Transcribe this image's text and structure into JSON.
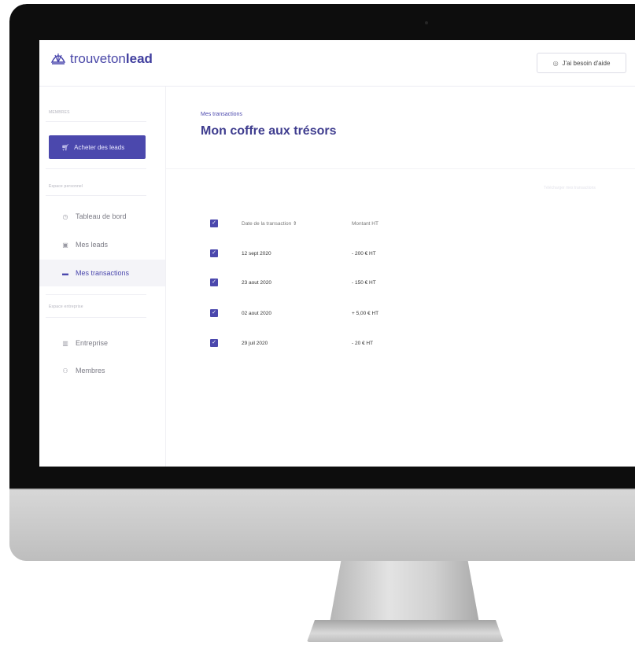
{
  "brand": {
    "name_light": "trouveton",
    "name_bold": "lead",
    "color": "#4b48ad"
  },
  "header": {
    "help_label": "J'ai besoin d'aide",
    "help_icon": "help-circle-icon"
  },
  "sidebar": {
    "section_top": "MEMBRES",
    "buy_button": "Acheter des leads",
    "section_personal": "Espace personnel",
    "items": [
      {
        "label": "Tableau de bord",
        "icon": "dashboard-icon",
        "active": false
      },
      {
        "label": "Mes leads",
        "icon": "leads-icon",
        "active": false
      },
      {
        "label": "Mes transactions",
        "icon": "transactions-icon",
        "active": true
      }
    ],
    "section_company": "Espace entreprise",
    "company_items": [
      {
        "label": "Entreprise",
        "icon": "building-icon"
      },
      {
        "label": "Membres",
        "icon": "members-icon"
      }
    ]
  },
  "main": {
    "breadcrumb": "Mes transactions",
    "title": "Mon coffre aux trésors",
    "faint_link": "Télécharger mes transactions",
    "table": {
      "col_date": "Date de la transaction ⇕",
      "col_amount": "Montant HT",
      "rows": [
        {
          "date": "12 sept 2020",
          "amount": "- 200 € HT"
        },
        {
          "date": "23 aout 2020",
          "amount": "- 150 € HT"
        },
        {
          "date": "02 aout 2020",
          "amount": "+ 5,00 € HT"
        },
        {
          "date": "29 juil 2020",
          "amount": "- 20 € HT"
        }
      ]
    }
  }
}
